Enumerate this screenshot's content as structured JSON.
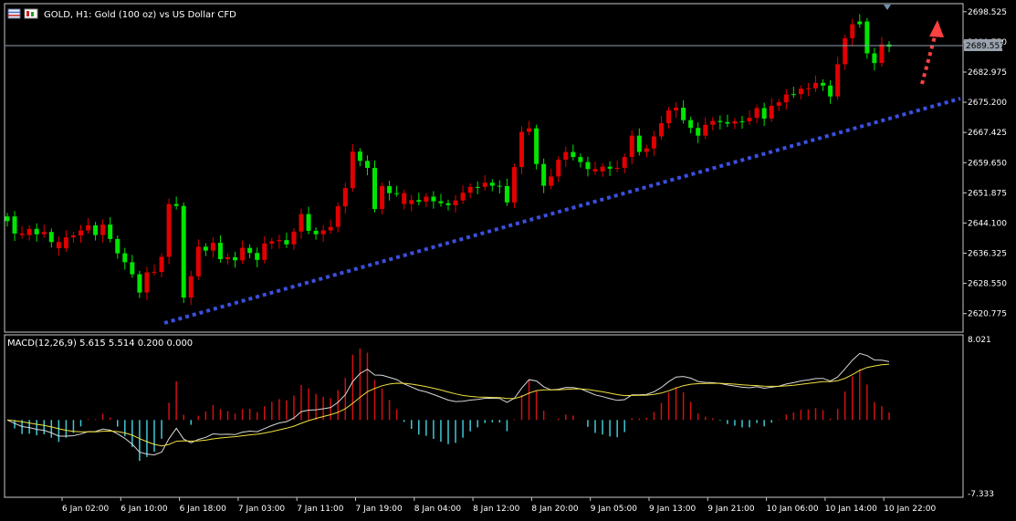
{
  "header": {
    "symbol_title": "GOLD, H1:  Gold (100 oz) vs US Dollar CFD"
  },
  "macd": {
    "label": "MACD(12,26,9) 5.615 5.514 0.200 0.000",
    "ticks": [
      "8.021",
      "-7.333"
    ]
  },
  "colors": {
    "background": "#000000",
    "bull_candle": "#00e600",
    "bear_candle": "#e00000",
    "trendline": "#3b4fe0",
    "arrow": "#ff4040",
    "hist_positive": "#d01010",
    "hist_negative": "#40c8d8",
    "macd_line": "#d8d8d8",
    "signal_line": "#f0e040"
  },
  "chart_data": {
    "type": "candlestick",
    "ylim": [
      2616.0,
      2700.6
    ],
    "y_ticks": [
      "2698.525",
      "2690.750",
      "2682.975",
      "2675.200",
      "2667.425",
      "2659.650",
      "2651.875",
      "2644.100",
      "2636.325",
      "2628.550",
      "2620.775"
    ],
    "current_price": "2689.557",
    "x_ticks": [
      "6 Jan 02:00",
      "6 Jan 10:00",
      "6 Jan 18:00",
      "7 Jan 03:00",
      "7 Jan 11:00",
      "7 Jan 19:00",
      "8 Jan 04:00",
      "8 Jan 12:00",
      "8 Jan 20:00",
      "9 Jan 05:00",
      "9 Jan 13:00",
      "9 Jan 21:00",
      "10 Jan 06:00",
      "10 Jan 14:00",
      "10 Jan 22:00"
    ],
    "candles_close": [
      2645.8,
      2641.4,
      2641.0,
      2642.6,
      2641.2,
      2641.8,
      2639.2,
      2637.6,
      2640.4,
      2640.9,
      2642.2,
      2643.5,
      2641.0,
      2643.7,
      2640.0,
      2636.3,
      2634.0,
      2630.9,
      2626.2,
      2631.4,
      2631.5,
      2635.4,
      2649.0,
      2648.5,
      2624.9,
      2630.4,
      2638.0,
      2637.0,
      2639.0,
      2634.8,
      2635.3,
      2634.5,
      2637.7,
      2636.4,
      2634.6,
      2638.8,
      2639.4,
      2639.7,
      2638.6,
      2641.9,
      2646.4,
      2642.1,
      2641.2,
      2642.2,
      2643.1,
      2648.4,
      2653.1,
      2662.5,
      2660.1,
      2658.3,
      2647.7,
      2653.6,
      2651.8,
      2651.8,
      2649.0,
      2650.0,
      2649.6,
      2650.9,
      2649.7,
      2649.2,
      2648.7,
      2649.9,
      2651.9,
      2653.4,
      2653.4,
      2654.5,
      2653.7,
      2653.6,
      2649.4,
      2658.5,
      2667.6,
      2668.5,
      2659.3,
      2653.7,
      2656.1,
      2660.4,
      2662.4,
      2661.1,
      2659.8,
      2658.0,
      2657.4,
      2658.6,
      2658.1,
      2658.3,
      2661.1,
      2666.6,
      2662.4,
      2663.3,
      2666.4,
      2669.8,
      2673.1,
      2673.8,
      2670.6,
      2668.6,
      2666.6,
      2669.4,
      2670.4,
      2670.1,
      2669.7,
      2670.3,
      2670.3,
      2671.2,
      2673.7,
      2671.0,
      2674.3,
      2675.2,
      2677.2,
      2677.3,
      2678.7,
      2678.8,
      2680.2,
      2679.5,
      2676.7,
      2685.0,
      2691.7,
      2695.3,
      2696.0,
      2687.8,
      2685.3,
      2690.1,
      2689.5
    ],
    "candles_bull": [
      true,
      true,
      false,
      false,
      true,
      false,
      true,
      false,
      false,
      false,
      false,
      false,
      true,
      false,
      true,
      true,
      true,
      true,
      true,
      false,
      false,
      false,
      false,
      true,
      true,
      false,
      false,
      true,
      false,
      true,
      false,
      true,
      false,
      true,
      true,
      false,
      false,
      false,
      true,
      false,
      false,
      true,
      true,
      false,
      false,
      false,
      false,
      false,
      true,
      true,
      true,
      false,
      true,
      true,
      false,
      false,
      true,
      false,
      true,
      true,
      true,
      false,
      false,
      false,
      true,
      false,
      true,
      true,
      true,
      false,
      false,
      false,
      true,
      true,
      false,
      false,
      false,
      true,
      true,
      true,
      false,
      false,
      true,
      false,
      false,
      false,
      true,
      false,
      false,
      false,
      false,
      false,
      true,
      true,
      true,
      false,
      false,
      true,
      true,
      false,
      true,
      false,
      false,
      true,
      false,
      false,
      false,
      true,
      false,
      false,
      false,
      true,
      true,
      false,
      false,
      false,
      true,
      true,
      true,
      false,
      true
    ]
  }
}
